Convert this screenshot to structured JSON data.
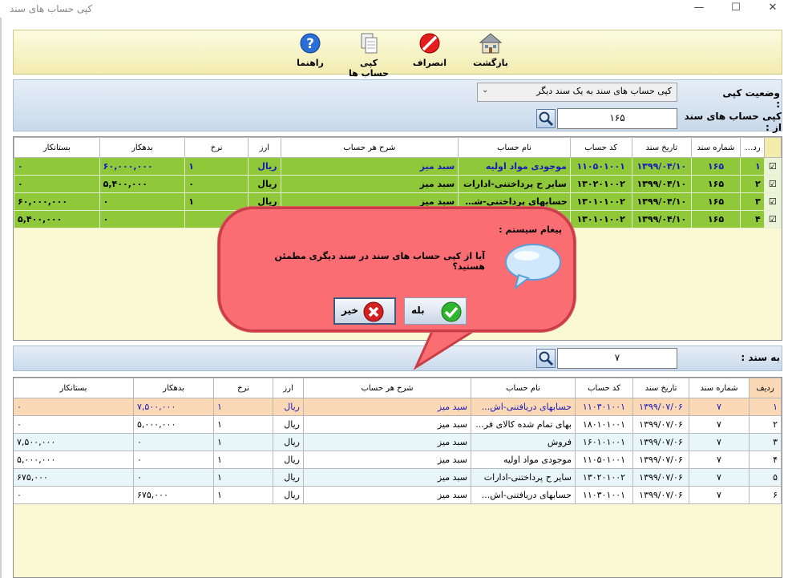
{
  "window": {
    "title": "کپی حساب های سند",
    "minimize": "—",
    "maximize": "☐",
    "close": "✕"
  },
  "toolbar": {
    "back_label": "بازگشت",
    "cancel_label": "انصراف",
    "copy_label": "کپی حساب ها",
    "help_label": "راهنما"
  },
  "form": {
    "copy_status_label": "وضعیت کپی :",
    "copy_status_value": "کپی حساب های سند به یک سند دیگر",
    "copy_from_label": "کپی حساب های سند از :",
    "copy_from_value": "۱۶۵",
    "to_doc_label": "به سند :",
    "to_doc_value": "۷"
  },
  "grid1": {
    "headers": [
      "ردیف",
      "شماره سند",
      "تاریخ سند",
      "کد حساب",
      "نام حساب",
      "شرح هر حساب",
      "ارز",
      "نرخ",
      "بدهکار",
      "بستانکار"
    ],
    "rows": [
      [
        "۱",
        "۱۶۵",
        "۱۳۹۹/۰۴/۱۰",
        "۱۱۰۵۰۱۰۰۱",
        "موجودی مواد اولیه",
        "سبد میز",
        "ریال",
        "۱",
        "۶۰,۰۰۰,۰۰۰",
        "۰"
      ],
      [
        "۲",
        "۱۶۵",
        "۱۳۹۹/۰۴/۱۰",
        "۱۳۰۲۰۱۰۰۲",
        "سایر ح پرداختنی-ادارات",
        "سبد میز",
        "ریال",
        "۰",
        "۵,۴۰۰,۰۰۰",
        "۰"
      ],
      [
        "۳",
        "۱۶۵",
        "۱۳۹۹/۰۴/۱۰",
        "۱۳۰۱۰۱۰۰۲",
        "حسابهای پرداختنی-شر...",
        "سبد میز",
        "ریال",
        "۱",
        "۰",
        "۶۰,۰۰۰,۰۰۰"
      ],
      [
        "۴",
        "۱۶۵",
        "۱۳۹۹/۰۴/۱۰",
        "۱۳۰۱۰۱۰۰۲",
        "",
        "",
        "",
        "",
        "۰",
        "۵,۴۰۰,۰۰۰"
      ]
    ]
  },
  "grid2": {
    "headers": [
      "ردیف",
      "شماره سند",
      "تاریخ سند",
      "کد حساب",
      "نام حساب",
      "شرح هر حساب",
      "ارز",
      "نرخ",
      "بدهکار",
      "بستانکار"
    ],
    "rows": [
      [
        "۱",
        "۷",
        "۱۳۹۹/۰۷/۰۶",
        "۱۱۰۳۰۱۰۰۱",
        "حسابهای دریافتنی-اش...",
        "سبد میز",
        "ریال",
        "۱",
        "۷,۵۰۰,۰۰۰",
        "۰"
      ],
      [
        "۲",
        "۷",
        "۱۳۹۹/۰۷/۰۶",
        "۱۸۰۱۰۱۰۰۱",
        "بهای تمام شده کالای فر...",
        "سبد میز",
        "ریال",
        "۱",
        "۵,۰۰۰,۰۰۰",
        "۰"
      ],
      [
        "۳",
        "۷",
        "۱۳۹۹/۰۷/۰۶",
        "۱۶۰۱۰۱۰۰۱",
        "فروش",
        "سبد میز",
        "ریال",
        "۱",
        "۰",
        "۷,۵۰۰,۰۰۰"
      ],
      [
        "۴",
        "۷",
        "۱۳۹۹/۰۷/۰۶",
        "۱۱۰۵۰۱۰۰۱",
        "موجودی مواد اولیه",
        "سبد میز",
        "ریال",
        "۱",
        "۰",
        "۵,۰۰۰,۰۰۰"
      ],
      [
        "۵",
        "۷",
        "۱۳۹۹/۰۷/۰۶",
        "۱۳۰۲۰۱۰۰۲",
        "سایر ح پرداختنی-ادارات",
        "سبد میز",
        "ریال",
        "۱",
        "۰",
        "۶۷۵,۰۰۰"
      ],
      [
        "۶",
        "۷",
        "۱۳۹۹/۰۷/۰۶",
        "۱۱۰۳۰۱۰۰۱",
        "حسابهای دریافتنی-اش...",
        "سبد میز",
        "ریال",
        "۱",
        "۶۷۵,۰۰۰",
        "۰"
      ]
    ]
  },
  "dialog": {
    "title": "پیغام سیستم :",
    "message": "آیا از کپی حساب های سند در سند دیگری مطمئن هستید؟",
    "yes_label": "بله",
    "no_label": "خیر"
  },
  "colors": {
    "selected_row": "#8fc93a",
    "dialog_bg": "#f96d73",
    "highlight_row": "#fbd9b7",
    "toolbar_bg": "#f2ecb0"
  }
}
